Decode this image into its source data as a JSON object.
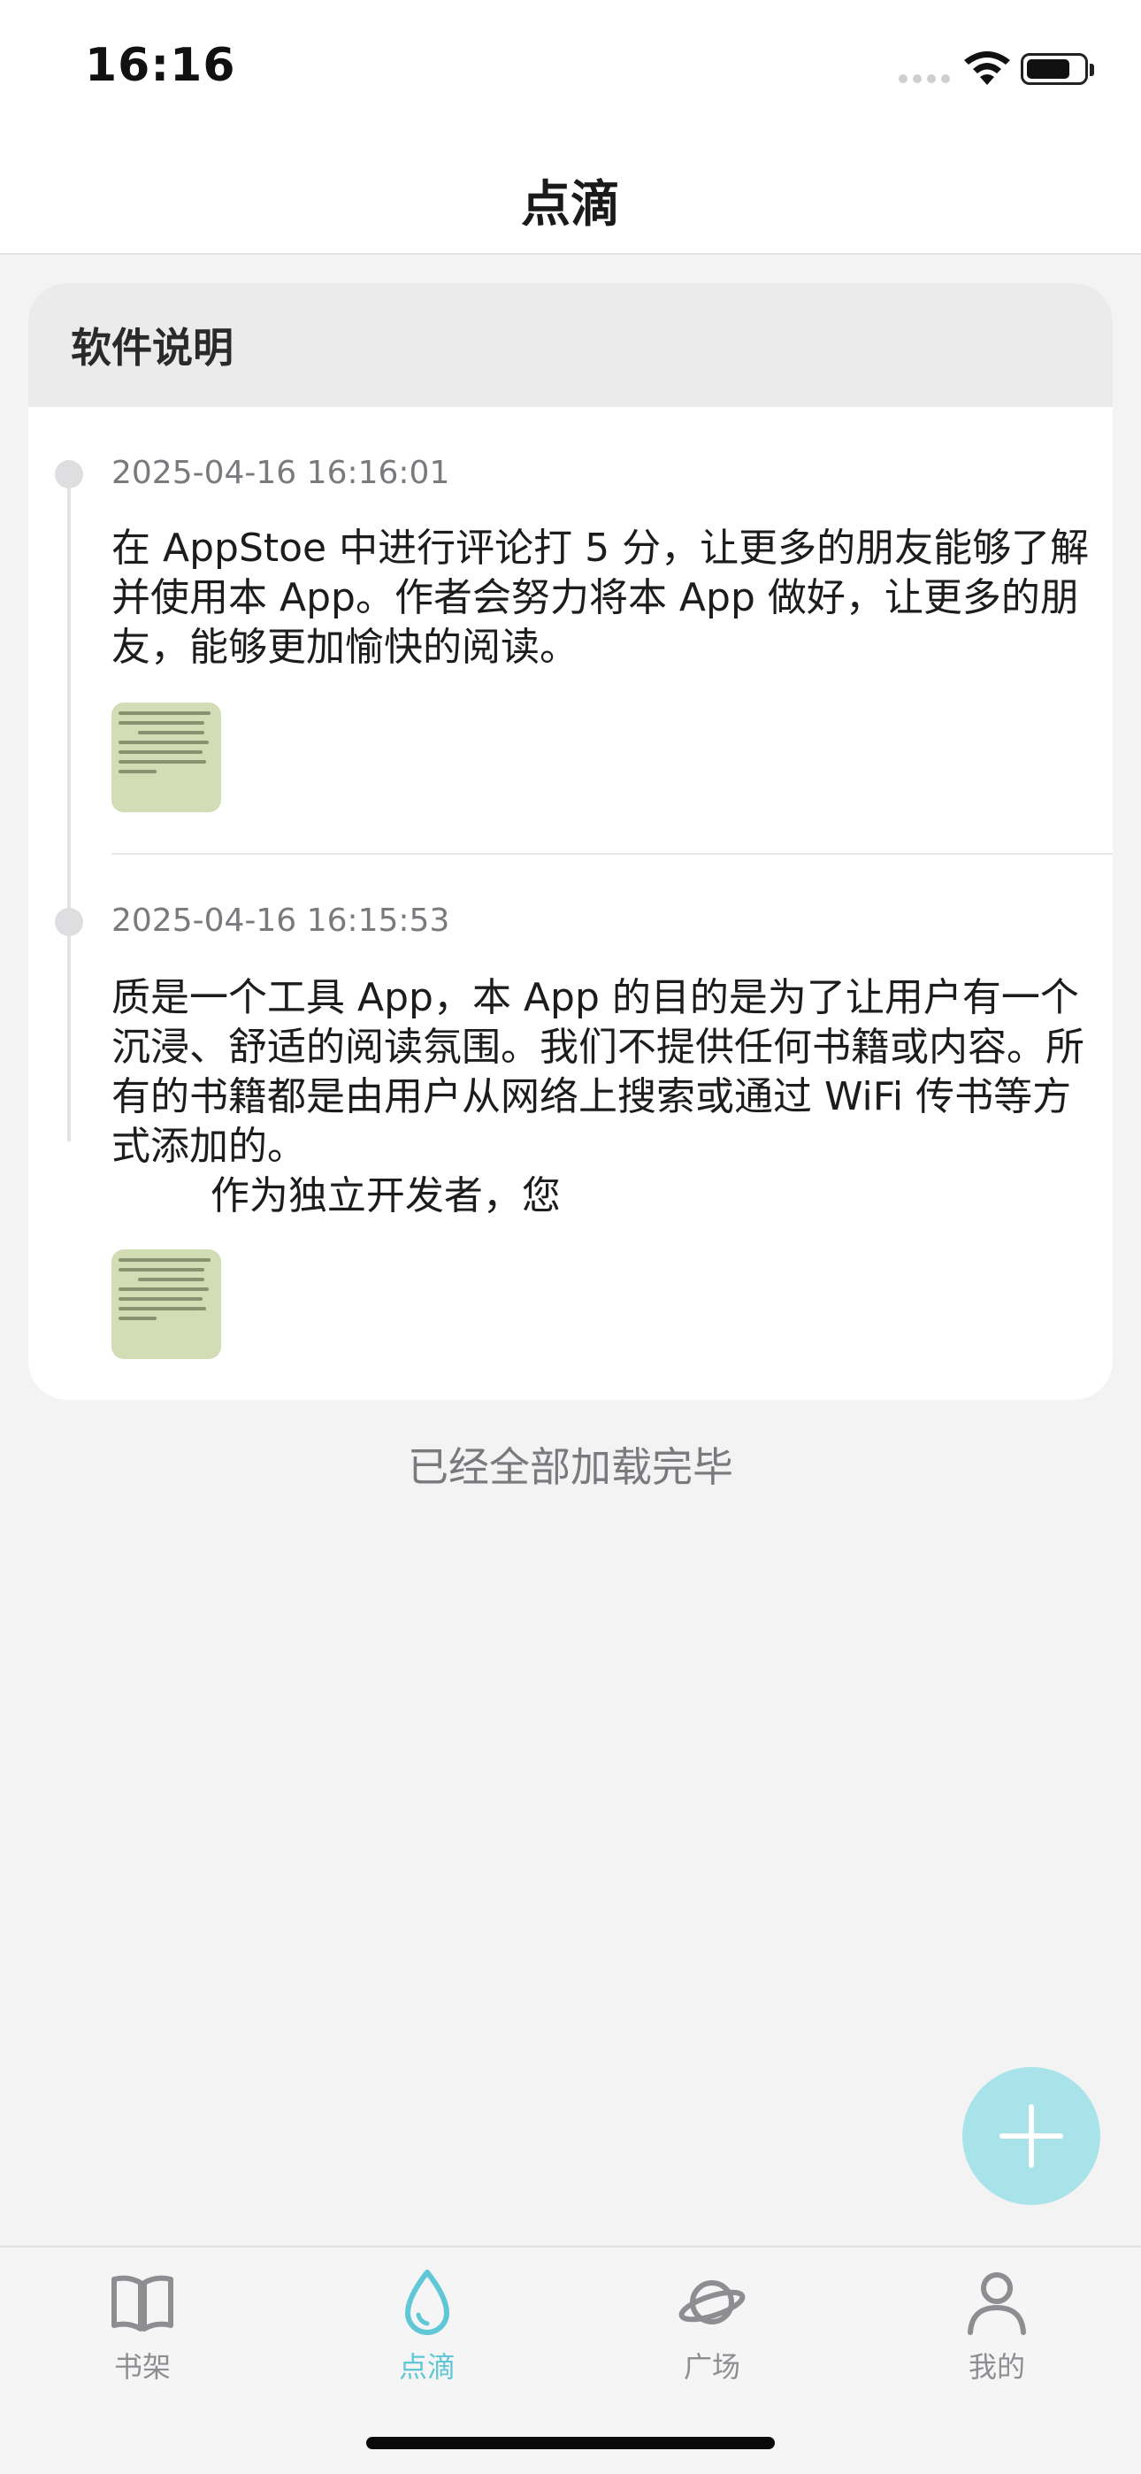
{
  "status_bar": {
    "time": "16:16"
  },
  "nav": {
    "title": "点滴"
  },
  "card": {
    "header_title": "软件说明",
    "entries": [
      {
        "timestamp": "2025-04-16 16:16:01",
        "text": "在 AppStoe 中进行评论打 5 分，让更多的朋友能够了解并使用本 App。作者会努力将本 App 做好，让更多的朋友，能够更加愉快的阅读。"
      },
      {
        "timestamp": "2025-04-16 16:15:53",
        "text": "质是一个工具 App，本 App 的目的是为了让用户有一个沉浸、舒适的阅读氛围。我们不提供任何书籍或内容。所有的书籍都是由用户从网络上搜索或通过 WiFi 传书等方式添加的。\n        作为独立开发者，您"
      }
    ]
  },
  "footer": {
    "load_complete": "已经全部加载完毕"
  },
  "fab": {
    "icon": "plus-icon"
  },
  "tabbar": {
    "tabs": [
      {
        "label": "书架",
        "icon": "book-icon",
        "active": false
      },
      {
        "label": "点滴",
        "icon": "drop-icon",
        "active": true
      },
      {
        "label": "广场",
        "icon": "planet-icon",
        "active": false
      },
      {
        "label": "我的",
        "icon": "person-icon",
        "active": false
      }
    ],
    "active_color": "#5fc7d6",
    "inactive_color": "#8e8e92"
  }
}
